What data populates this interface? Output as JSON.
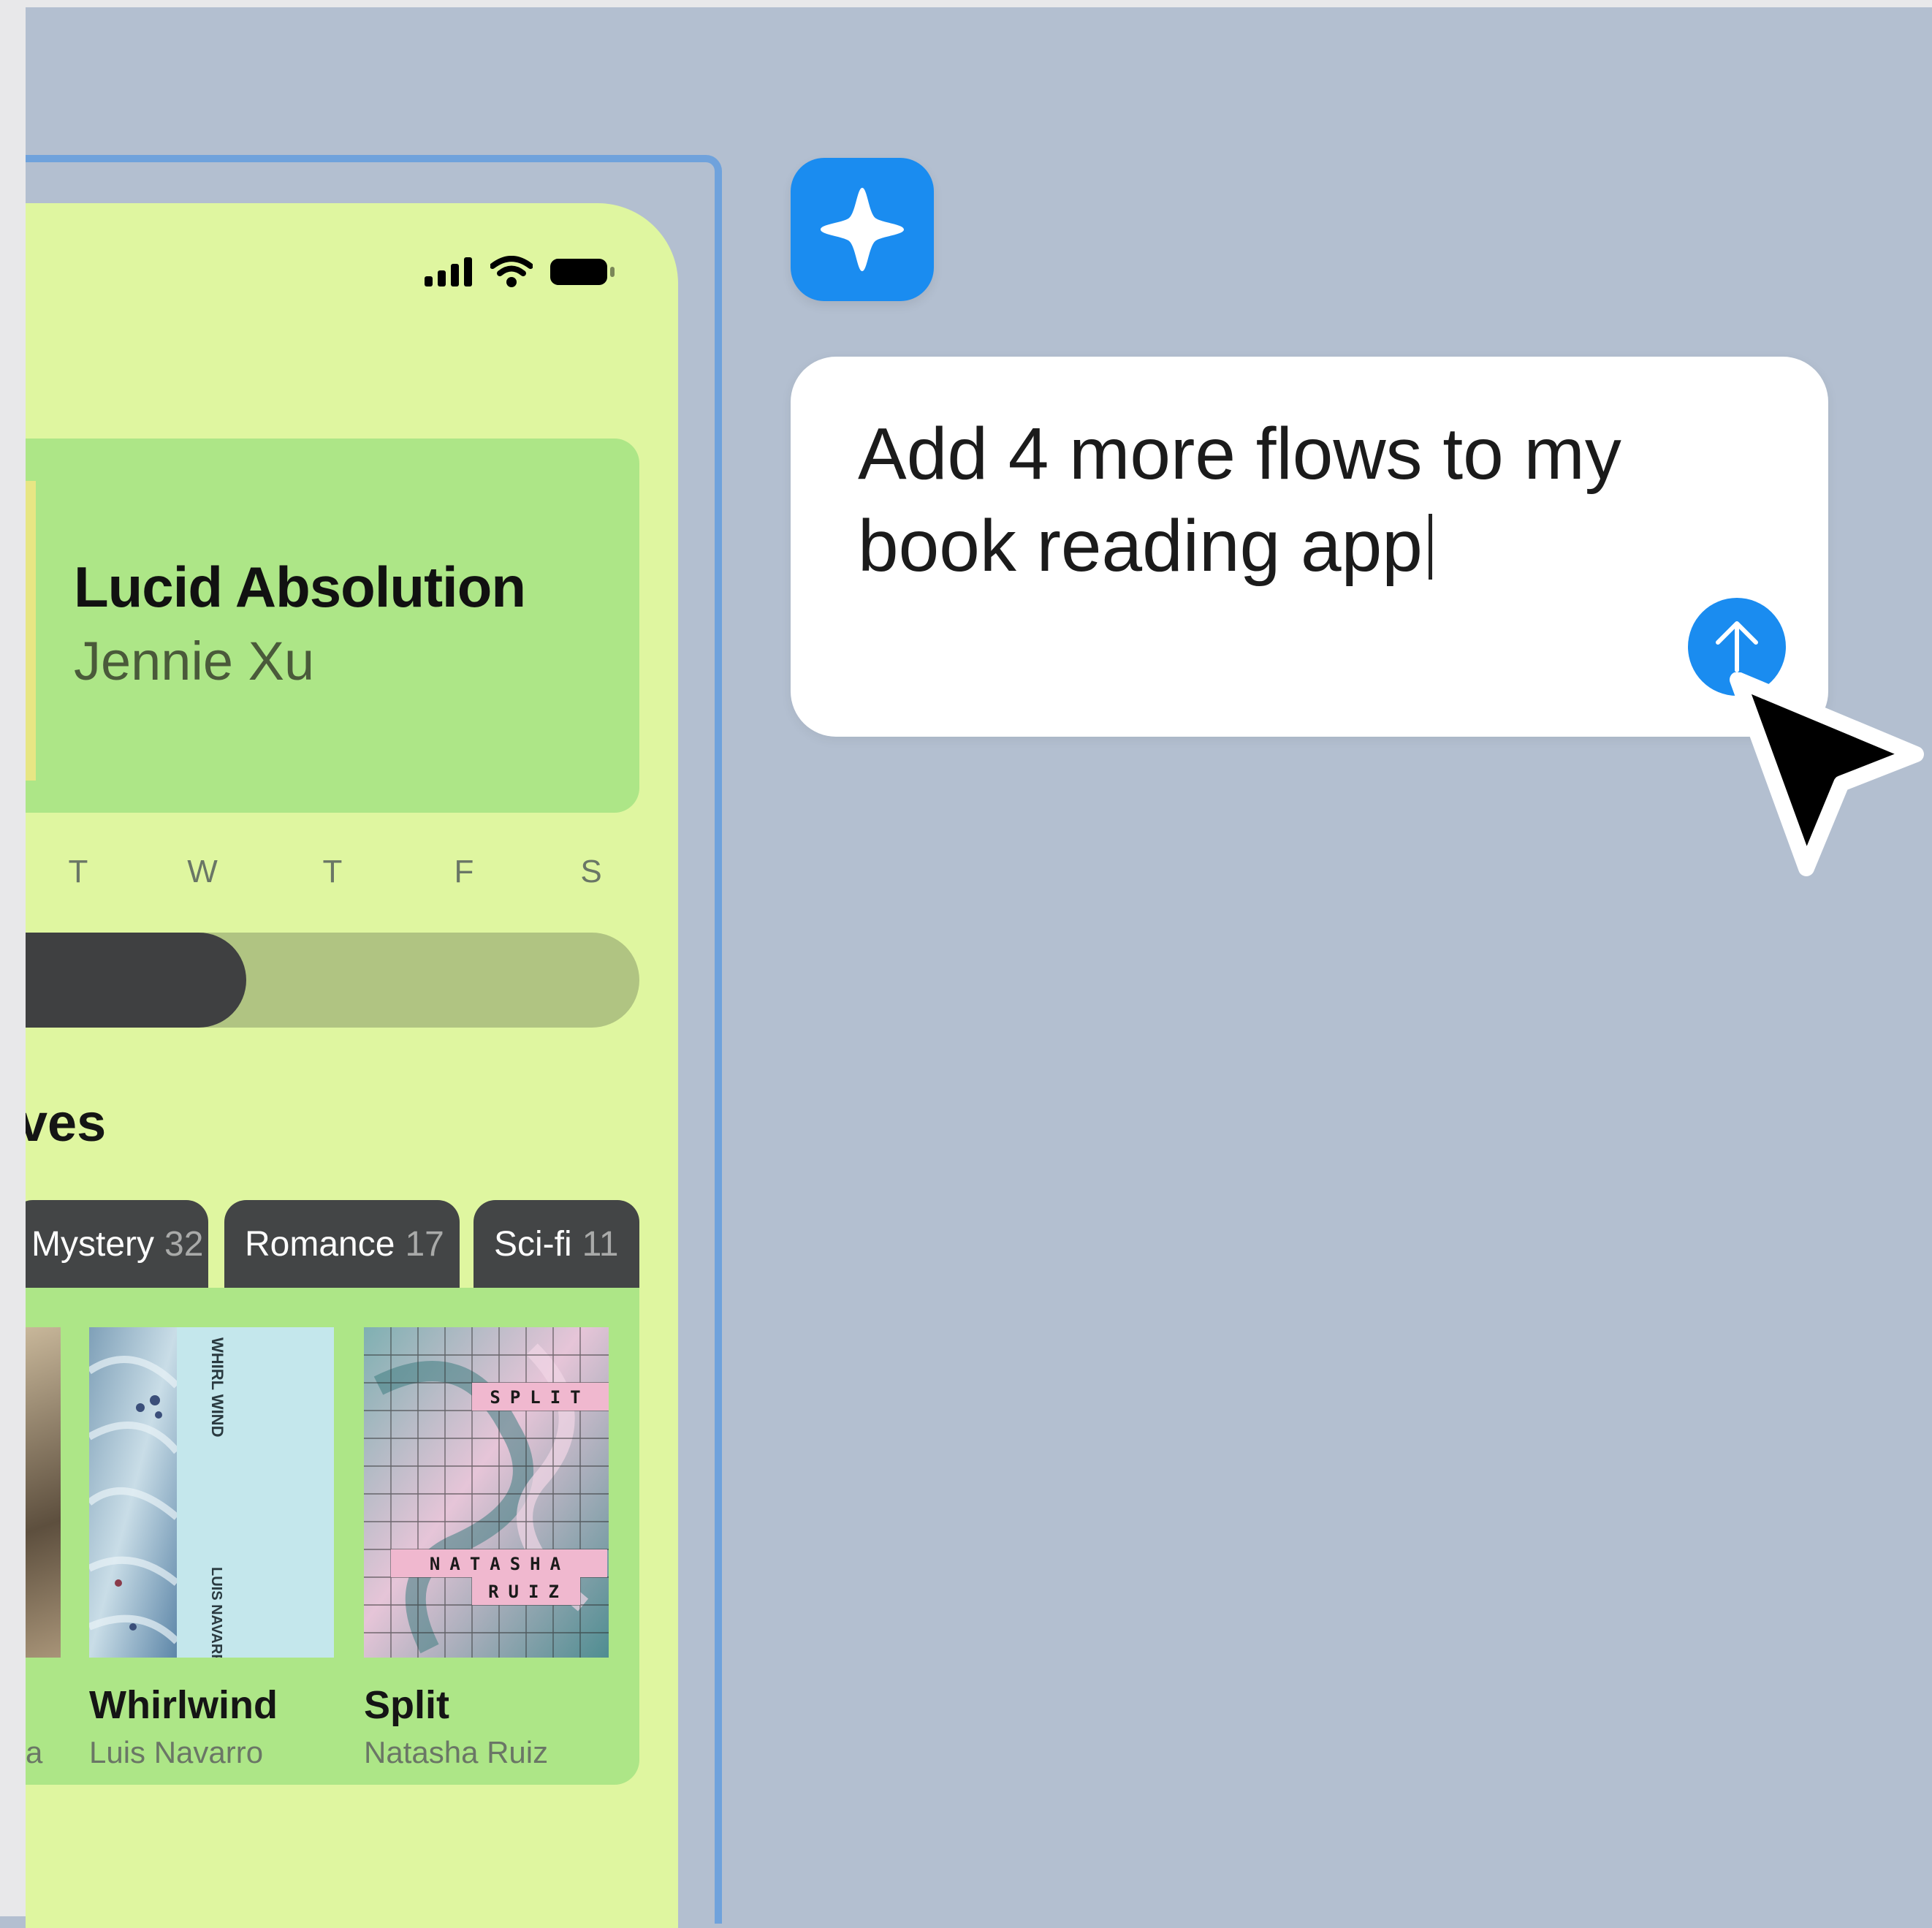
{
  "colors": {
    "canvas": "#b3bfd0",
    "frame_outline": "#6fa2dc",
    "phone_background": "#dff6a0",
    "card_green": "#ade687",
    "dark": "#434546",
    "accent_blue": "#1a8cf0"
  },
  "status_bar": {
    "icons": [
      "signal-icon",
      "wifi-icon",
      "battery-icon"
    ]
  },
  "now_reading": {
    "title": "Lucid Absolution",
    "author": "Jennie Xu"
  },
  "week": {
    "days": [
      "T",
      "W",
      "T",
      "F",
      "S"
    ],
    "progress_fraction": 0.36
  },
  "shelves": {
    "heading": "ves",
    "tabs": [
      {
        "label": "Mystery",
        "count": "32"
      },
      {
        "label": "Romance",
        "count": "17"
      },
      {
        "label": "Sci-fi",
        "count": "11"
      }
    ],
    "books": [
      {
        "title": "",
        "author": "a"
      },
      {
        "title": "Whirlwind",
        "author": "Luis Navarro",
        "cover_text_top": "WHIRL WIND",
        "cover_text_bottom": "LUIS NAVARRO"
      },
      {
        "title": "Split",
        "author": "Natasha Ruiz",
        "cover_word": "SPLIT",
        "cover_name_1": "NATASHA",
        "cover_name_2": "RUIZ"
      }
    ]
  },
  "assistant": {
    "badge_icon": "sparkle-icon",
    "prompt": "Add 4 more flows to my book reading app",
    "send_icon": "arrow-up-icon",
    "pointer_icon": "cursor-icon"
  }
}
